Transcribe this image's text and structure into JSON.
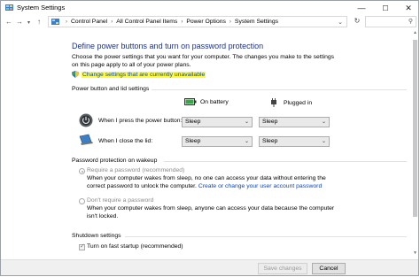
{
  "window": {
    "title": "System Settings",
    "controls": {
      "minimize": "—",
      "maximize": "☐",
      "close": "✕"
    }
  },
  "address": {
    "crumbs": [
      "Control Panel",
      "All Control Panel Items",
      "Power Options",
      "System Settings"
    ]
  },
  "page": {
    "heading": "Define power buttons and turn on password protection",
    "description": "Choose the power settings that you want for your computer. The changes you make to the settings on this page apply to all of your power plans.",
    "change_link": "Change settings that are currently unavailable"
  },
  "power_buttons": {
    "group_label": "Power button and lid settings",
    "col_battery": "On battery",
    "col_plugged": "Plugged in",
    "rows": [
      {
        "label": "When I press the power button:",
        "battery": "Sleep",
        "plugged": "Sleep"
      },
      {
        "label": "When I close the lid:",
        "battery": "Sleep",
        "plugged": "Sleep"
      }
    ]
  },
  "password": {
    "group_label": "Password protection on wakeup",
    "options": [
      {
        "label": "Require a password (recommended)",
        "selected": true,
        "desc_before": "When your computer wakes from sleep, no one can access your data without entering the correct password to unlock the computer. ",
        "link": "Create or change your user account password"
      },
      {
        "label": "Don't require a password",
        "selected": false,
        "desc_before": "When your computer wakes from sleep, anyone can access your data because the computer isn't locked.",
        "link": ""
      }
    ]
  },
  "shutdown": {
    "group_label": "Shutdown settings",
    "fast_startup": {
      "label": "Turn on fast startup (recommended)",
      "checked": true
    }
  },
  "footer": {
    "save_label": "Save changes",
    "cancel_label": "Cancel"
  },
  "colors": {
    "heading": "#1e3287",
    "link": "#0645c8",
    "highlight": "#fffb3a"
  }
}
